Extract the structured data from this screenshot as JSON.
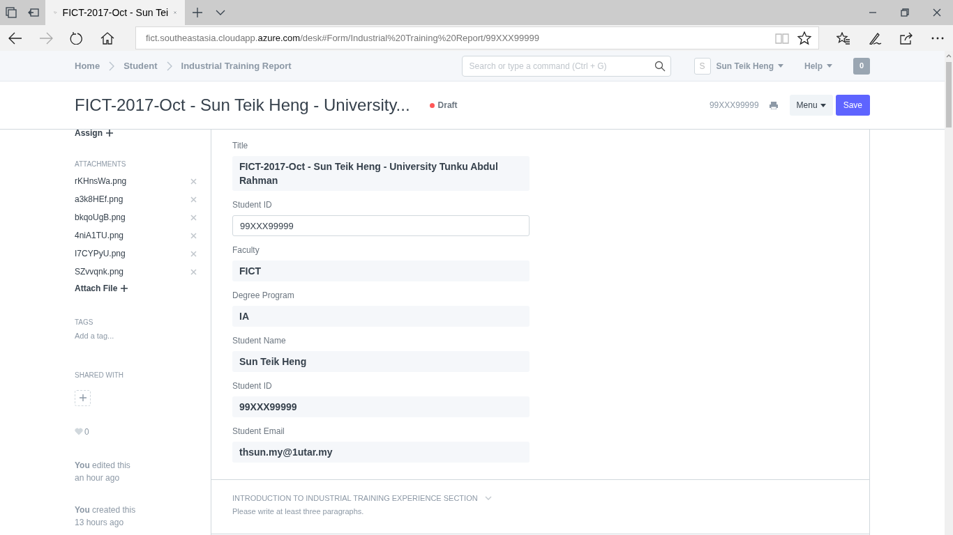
{
  "browser": {
    "tab_title": "FICT-2017-Oct - Sun Tei",
    "url_prefix": "fict.southeastasia.cloudapp.",
    "url_domain": "azure.com",
    "url_path": "/desk#Form/Industrial%20Training%20Report/99XXX99999"
  },
  "breadcrumbs": [
    "Home",
    "Student",
    "Industrial Training Report"
  ],
  "search": {
    "placeholder": "Search or type a command (Ctrl + G)"
  },
  "user": {
    "avatar_letter": "S",
    "name": "Sun Teik Heng"
  },
  "help": "Help",
  "notifications": "0",
  "header": {
    "title": "FICT-2017-Oct - Sun Teik Heng - University...",
    "status": "Draft",
    "doc_name": "99XXX99999",
    "menu": "Menu",
    "save": "Save"
  },
  "sidebar": {
    "assign": "Assign",
    "attachments_heading": "ATTACHMENTS",
    "attachments": [
      "rKHnsWa.png",
      "a3k8HEf.png",
      "bkqoUgB.png",
      "4niA1TU.png",
      "I7CYPyU.png",
      "SZvvqnk.png"
    ],
    "attach_file": "Attach File",
    "tags_heading": "TAGS",
    "add_tag": "Add a tag...",
    "shared_heading": "SHARED WITH",
    "likes": "0",
    "activity": [
      {
        "text": "**You** edited this",
        "time": "an hour ago"
      },
      {
        "text": "**You** created this",
        "time": "13 hours ago"
      }
    ]
  },
  "fields": [
    {
      "label": "Title",
      "kind": "readonly",
      "value": "FICT-2017-Oct - Sun Teik Heng - University Tunku Abdul Rahman"
    },
    {
      "label": "Student ID",
      "kind": "input",
      "value": "99XXX99999"
    },
    {
      "label": "Faculty",
      "kind": "readonly",
      "value": "FICT"
    },
    {
      "label": "Degree Program",
      "kind": "readonly",
      "value": "IA"
    },
    {
      "label": "Student Name",
      "kind": "readonly",
      "value": "Sun Teik Heng"
    },
    {
      "label": "Student ID",
      "kind": "readonly",
      "value": "99XXX99999"
    },
    {
      "label": "Student Email",
      "kind": "readonly",
      "value": "thsun.my@1utar.my"
    }
  ],
  "section": {
    "title": "INTRODUCTION TO INDUSTRIAL TRAINING EXPERIENCE SECTION",
    "expanded": false,
    "description": "Please write at least three paragraphs."
  }
}
